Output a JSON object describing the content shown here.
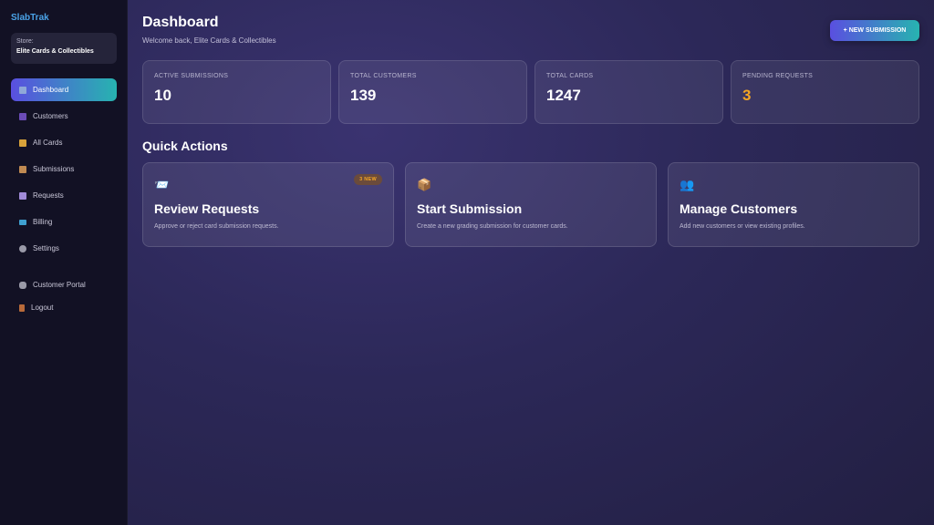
{
  "sidebar": {
    "brand": "SlabTrak",
    "store_label": "Store:",
    "store_name": "Elite Cards & Collectibles",
    "items": [
      {
        "label": "Dashboard",
        "icon": "chart-icon",
        "active": true
      },
      {
        "label": "Customers",
        "icon": "users-icon"
      },
      {
        "label": "All Cards",
        "icon": "cards-icon"
      },
      {
        "label": "Submissions",
        "icon": "package-icon"
      },
      {
        "label": "Requests",
        "icon": "inbox-icon"
      },
      {
        "label": "Billing",
        "icon": "credit-card-icon"
      },
      {
        "label": "Settings",
        "icon": "gear-icon"
      },
      {
        "label": "Customer Portal",
        "icon": "link-icon"
      },
      {
        "label": "Logout",
        "icon": "door-icon"
      }
    ]
  },
  "header": {
    "title": "Dashboard",
    "subtitle": "Welcome back, Elite Cards & Collectibles",
    "new_button": "+ NEW SUBMISSION"
  },
  "stats": [
    {
      "label": "ACTIVE SUBMISSIONS",
      "value": "10"
    },
    {
      "label": "TOTAL CUSTOMERS",
      "value": "139"
    },
    {
      "label": "TOTAL CARDS",
      "value": "1247"
    },
    {
      "label": "PENDING REQUESTS",
      "value": "3"
    }
  ],
  "quick_actions": {
    "title": "Quick Actions",
    "cards": [
      {
        "icon": "📨",
        "title": "Review Requests",
        "desc": "Approve or reject card submission requests.",
        "badge": "3 NEW"
      },
      {
        "icon": "📦",
        "title": "Start Submission",
        "desc": "Create a new grading submission for customer cards."
      },
      {
        "icon": "👥",
        "title": "Manage Customers",
        "desc": "Add new customers or view existing profiles."
      }
    ]
  },
  "colors": {
    "accent_start": "#5a4fe0",
    "accent_end": "#27b3b0",
    "warning": "#f5a623",
    "sidebar_bg": "#121124"
  }
}
